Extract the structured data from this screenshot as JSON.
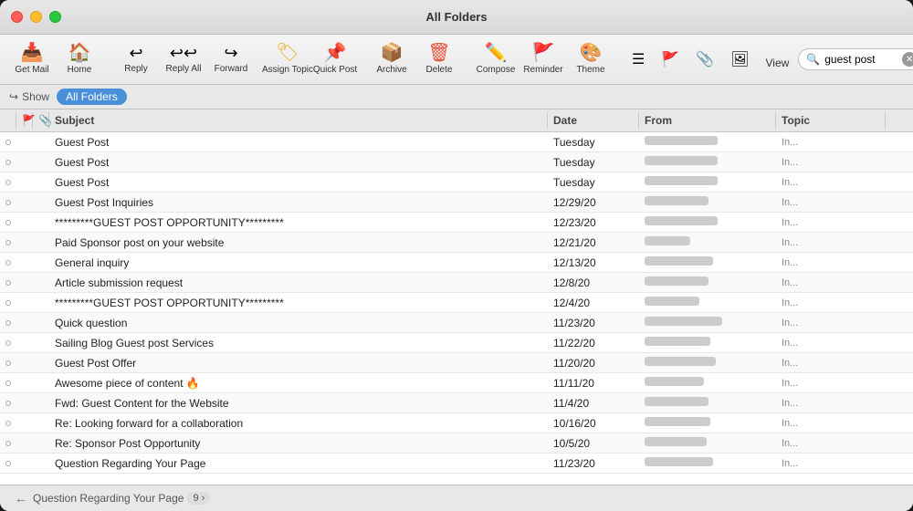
{
  "window": {
    "title": "All Folders"
  },
  "toolbar": {
    "buttons": [
      {
        "id": "get-mail",
        "label": "Get Mail",
        "icon": "📥"
      },
      {
        "id": "home",
        "label": "Home",
        "icon": "🏠"
      },
      {
        "id": "reply",
        "label": "Reply",
        "icon": "↩"
      },
      {
        "id": "reply-all",
        "label": "Reply All",
        "icon": "↩↩"
      },
      {
        "id": "forward",
        "label": "Forward",
        "icon": "↪"
      },
      {
        "id": "assign-topic",
        "label": "Assign Topic",
        "icon": "🏷"
      },
      {
        "id": "quick-post",
        "label": "Quick Post",
        "icon": "📌"
      },
      {
        "id": "archive",
        "label": "Archive",
        "icon": "📦"
      },
      {
        "id": "delete",
        "label": "Delete",
        "icon": "🗑"
      },
      {
        "id": "compose",
        "label": "Compose",
        "icon": "✏️"
      },
      {
        "id": "reminder",
        "label": "Reminder",
        "icon": "🚩"
      },
      {
        "id": "theme",
        "label": "Theme",
        "icon": "🎨"
      }
    ],
    "view": {
      "label": "View",
      "icons": [
        "☰",
        "🚩",
        "📎",
        "🖼"
      ]
    },
    "search": {
      "placeholder": "guest post",
      "value": "guest post"
    }
  },
  "subbar": {
    "show_label": "Show",
    "tag": "All Folders"
  },
  "list_header": {
    "columns": [
      "",
      "",
      "",
      "Subject",
      "Date",
      "From",
      "Topic",
      ""
    ]
  },
  "emails": [
    {
      "subject": "Guest Post",
      "date": "Tuesday",
      "from_width": 80,
      "topic": "In...",
      "unread": false
    },
    {
      "subject": "Guest Post",
      "date": "Tuesday",
      "from_width": 80,
      "topic": "In...",
      "unread": false
    },
    {
      "subject": "Guest Post",
      "date": "Tuesday",
      "from_width": 80,
      "topic": "In...",
      "unread": false
    },
    {
      "subject": "Guest Post Inquiries",
      "date": "12/29/20",
      "from_width": 70,
      "topic": "In...",
      "unread": false
    },
    {
      "subject": "*********GUEST POST OPPORTUNITY*********",
      "date": "12/23/20",
      "from_width": 80,
      "topic": "In...",
      "unread": false
    },
    {
      "subject": "Paid Sponsor post on your website",
      "date": "12/21/20",
      "from_width": 50,
      "topic": "In...",
      "unread": false
    },
    {
      "subject": "General inquiry",
      "date": "12/13/20",
      "from_width": 75,
      "topic": "In...",
      "unread": false
    },
    {
      "subject": "Article submission request",
      "date": "12/8/20",
      "from_width": 70,
      "topic": "In...",
      "unread": false
    },
    {
      "subject": "*********GUEST POST OPPORTUNITY*********",
      "date": "12/4/20",
      "from_width": 60,
      "topic": "In...",
      "unread": false
    },
    {
      "subject": "Quick question",
      "date": "11/23/20",
      "from_width": 85,
      "topic": "In...",
      "unread": false
    },
    {
      "subject": "Sailing Blog Guest post Services",
      "date": "11/22/20",
      "from_width": 72,
      "topic": "In...",
      "unread": false
    },
    {
      "subject": "Guest Post Offer",
      "date": "11/20/20",
      "from_width": 78,
      "topic": "In...",
      "unread": false
    },
    {
      "subject": "Awesome piece of content 🔥",
      "date": "11/11/20",
      "from_width": 65,
      "topic": "In...",
      "unread": false
    },
    {
      "subject": "Fwd: Guest Content for the Website",
      "date": "11/4/20",
      "from_width": 70,
      "topic": "In...",
      "unread": false
    },
    {
      "subject": "Re: Looking forward for a collaboration",
      "date": "10/16/20",
      "from_width": 72,
      "topic": "In...",
      "unread": false
    },
    {
      "subject": "Re: Sponsor Post Opportunity",
      "date": "10/5/20",
      "from_width": 68,
      "topic": "In...",
      "unread": false
    },
    {
      "subject": "Question Regarding Your Page",
      "date": "11/23/20",
      "from_width": 75,
      "topic": "In...",
      "unread": false
    }
  ],
  "bottom_bar": {
    "badge_count": "9 ›",
    "nav_back": "←"
  }
}
